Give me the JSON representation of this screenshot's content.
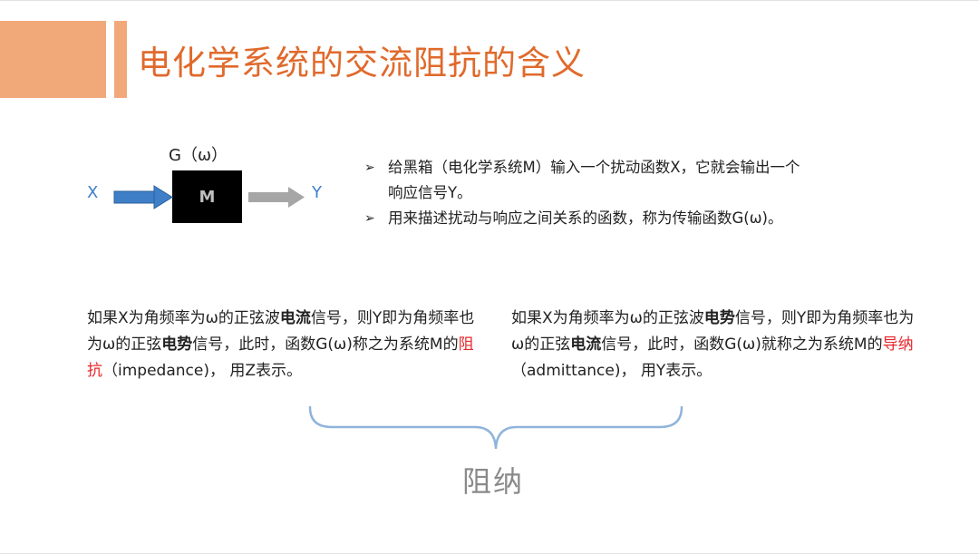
{
  "title": "电化学系统的交流阻抗的含义",
  "diagram": {
    "g_label": "G（ω）",
    "box_label": "M",
    "x_label": "X",
    "y_label": "Y"
  },
  "bullets": [
    {
      "line1": "给黑箱（电化学系统M）输入一个扰动函数X，它就会输出一个",
      "line2": "响应信号Y。"
    },
    {
      "line1": "用来描述扰动与响应之间关系的函数，称为传输函数G(ω)。"
    }
  ],
  "left_para": {
    "p1": "如果X为角频率为ω的正弦波",
    "b1": "电流",
    "p2": "信号，则Y即为角频率也为ω的正弦",
    "b2": "电势",
    "p3": "信号，此时，函数G(ω)称之为系统M的",
    "term": "阻抗",
    "p4": "（impedance)， 用Z表示。"
  },
  "right_para": {
    "p1": "如果X为角频率为ω的正弦波",
    "b1": "电势",
    "p2": "信号，则Y即为角频率也为ω的正弦",
    "b2": "电流",
    "p3": "信号，此时，函数G(ω)就称之为系统M的",
    "term": "导纳",
    "p4": "（admittance)， 用Y表示。"
  },
  "bottom_label": "阻纳",
  "colors": {
    "accent": "#f2a97a",
    "title": "#e06a2c",
    "highlight": "#e8252a",
    "input_arrow": "#3f7fc7",
    "output_arrow": "#a6a6a6",
    "brace": "#8fb4dc"
  }
}
